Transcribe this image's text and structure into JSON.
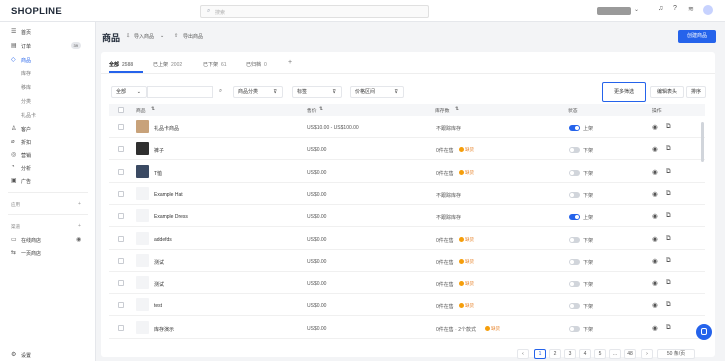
{
  "brand": {
    "logo": "SHOPLINE"
  },
  "topbar": {
    "search_placeholder": "搜索"
  },
  "sidebar": {
    "items": [
      {
        "label": "首页",
        "icon": "home-icon",
        "glyph": "☰"
      },
      {
        "label": "订单",
        "icon": "order-icon",
        "glyph": "▤",
        "badge": "39"
      },
      {
        "label": "商品",
        "icon": "product-icon",
        "glyph": "◇"
      }
    ],
    "product_sub": [
      "库存",
      "移库",
      "分类",
      "礼品卡"
    ],
    "items2": [
      {
        "label": "客户",
        "icon": "customer-icon",
        "glyph": "♙"
      },
      {
        "label": "折扣",
        "icon": "discount-icon",
        "glyph": "⌀"
      },
      {
        "label": "营销",
        "icon": "marketing-icon",
        "glyph": "◎"
      },
      {
        "label": "分析",
        "icon": "analytics-icon",
        "glyph": "◔"
      },
      {
        "label": "广告",
        "icon": "ads-icon",
        "glyph": "▣"
      }
    ],
    "section_apps": "应用",
    "section_channels": "渠道",
    "channels": [
      {
        "label": "在线商店",
        "icon": "online-store-icon",
        "glyph": "▭"
      },
      {
        "label": "一页商店",
        "icon": "one-page-icon",
        "glyph": "⇆"
      }
    ],
    "settings": "设置"
  },
  "page": {
    "title": "商品",
    "import_label": "导入商品",
    "export_label": "导出商品",
    "create_button": "创建商品"
  },
  "tabs": [
    {
      "label": "全部",
      "count": "2588"
    },
    {
      "label": "已上架",
      "count": "2002"
    },
    {
      "label": "已下架",
      "count": "61"
    },
    {
      "label": "已归档",
      "count": "0"
    }
  ],
  "filters": {
    "select_value": "全部",
    "category": "商品分类",
    "tags": "标签",
    "price_range": "价格区间",
    "more_filters": "更多筛选",
    "edit_columns": "编辑表头",
    "sort": "排序"
  },
  "table": {
    "headers": [
      "商品",
      "售价",
      "库存数",
      "状态",
      "操作"
    ],
    "rows": [
      {
        "name": "礼品卡商品",
        "price": "US$10.00 - US$100.00",
        "stock": "不跟踪库存",
        "warn": "",
        "on": true,
        "status": "上架",
        "thumb": "#c8a27a"
      },
      {
        "name": "裤子",
        "price": "US$0.00",
        "stock": "0件在售",
        "warn": "缺货",
        "on": false,
        "status": "下架",
        "thumb": "#2f2f2f"
      },
      {
        "name": "T恤",
        "price": "US$0.00",
        "stock": "0件在售",
        "warn": "缺货",
        "on": false,
        "status": "下架",
        "thumb": "#3b4a63"
      },
      {
        "name": "Example Hat",
        "price": "US$0.00",
        "stock": "不跟踪库存",
        "warn": "",
        "on": false,
        "status": "下架",
        "thumb": ""
      },
      {
        "name": "Example Dress",
        "price": "US$0.00",
        "stock": "不跟踪库存",
        "warn": "",
        "on": true,
        "status": "上架",
        "thumb": ""
      },
      {
        "name": "addefds",
        "price": "US$0.00",
        "stock": "0件在售",
        "warn": "缺货",
        "on": false,
        "status": "下架",
        "thumb": ""
      },
      {
        "name": "测试",
        "price": "US$0.00",
        "stock": "0件在售",
        "warn": "缺货",
        "on": false,
        "status": "下架",
        "thumb": ""
      },
      {
        "name": "测试",
        "price": "US$0.00",
        "stock": "0件在售",
        "warn": "缺货",
        "on": false,
        "status": "下架",
        "thumb": ""
      },
      {
        "name": "test",
        "price": "US$0.00",
        "stock": "0件在售",
        "warn": "缺货",
        "on": false,
        "status": "下架",
        "thumb": ""
      },
      {
        "name": "库存演示",
        "price": "US$0.00",
        "stock": "0件在售 · 2个款式",
        "warn": "缺货",
        "on": false,
        "status": "下架",
        "thumb": ""
      }
    ]
  },
  "pagination": {
    "pages": [
      "1",
      "2",
      "3",
      "4",
      "5",
      "…",
      "48"
    ],
    "per_page": "50 条/页"
  },
  "colors": {
    "accent": "#2563eb",
    "warning": "#f59e0b"
  }
}
